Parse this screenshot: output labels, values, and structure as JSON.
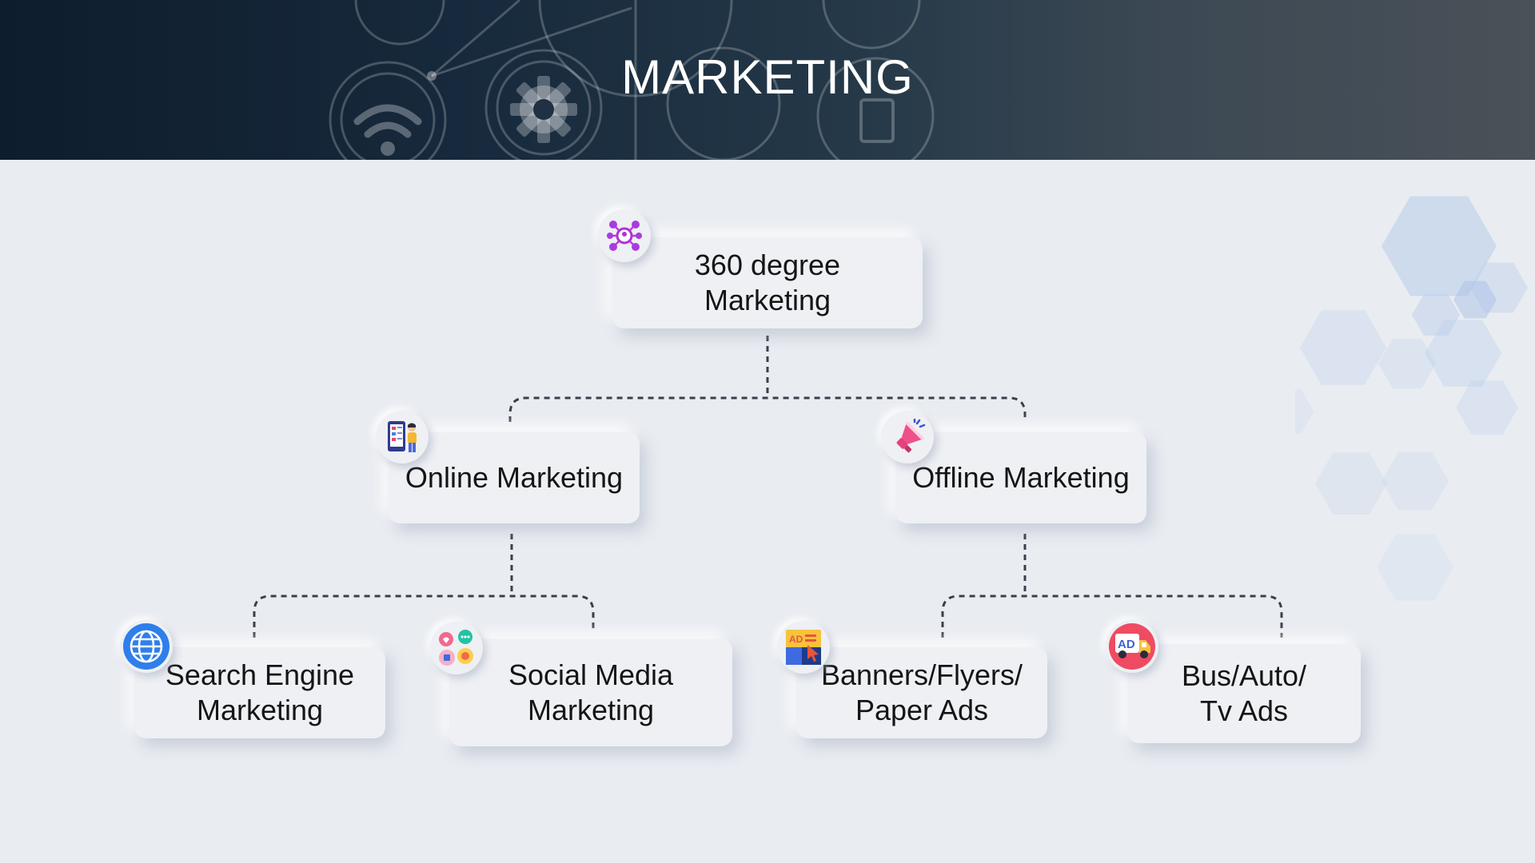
{
  "header": {
    "title": "MARKETING"
  },
  "diagram": {
    "root": {
      "label": "360 degree\nMarketing",
      "icon": "network-icon"
    },
    "branches": [
      {
        "label": "Online Marketing",
        "icon": "mobile-user-icon",
        "children": [
          {
            "label": "Search Engine\nMarketing",
            "icon": "globe-icon"
          },
          {
            "label": "Social Media\nMarketing",
            "icon": "social-bubbles-icon"
          }
        ]
      },
      {
        "label": "Offline Marketing",
        "icon": "megaphone-icon",
        "children": [
          {
            "label": "Banners/Flyers/\nPaper Ads",
            "icon": "billboard-icon"
          },
          {
            "label": "Bus/Auto/\nTv Ads",
            "icon": "ad-truck-icon"
          }
        ]
      }
    ]
  },
  "colors": {
    "background": "#e9ecf1",
    "card": "#eef0f4",
    "connector": "#3a3f4d",
    "hexagon": "#b8cdea"
  }
}
